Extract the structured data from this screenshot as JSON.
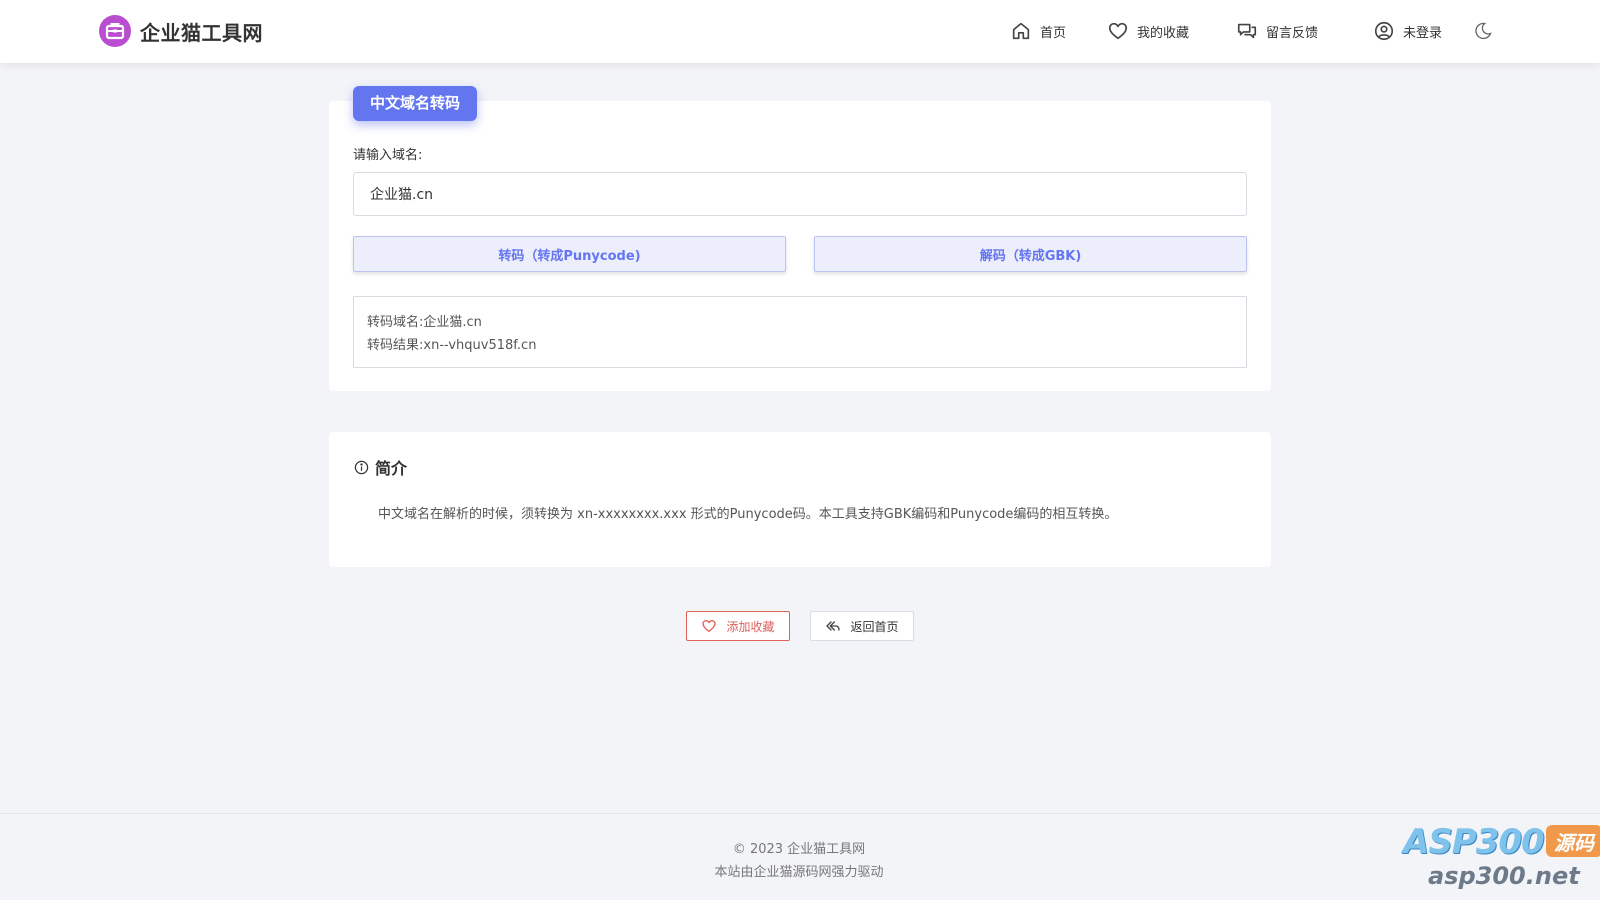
{
  "header": {
    "logo_text": "企业猫工具网",
    "nav": {
      "home": "首页",
      "favorites": "我的收藏",
      "feedback": "留言反馈",
      "login": "未登录"
    }
  },
  "tool": {
    "title": "中文域名转码",
    "input_label": "请输入域名:",
    "input_value": "企业猫.cn",
    "encode_button": "转码（转成Punycode)",
    "decode_button": "解码（转成GBK)",
    "result": {
      "domain_label": "转码域名:",
      "domain_value": "企业猫.cn",
      "result_label": "转码结果:",
      "result_value": "xn--vhquv518f.cn"
    }
  },
  "intro": {
    "title": "简介",
    "text": "中文域名在解析的时候，须转换为 xn-xxxxxxxx.xxx 形式的Punycode码。本工具支持GBK编码和Punycode编码的相互转换。"
  },
  "actions": {
    "add_favorite": "添加收藏",
    "back_home": "返回首页"
  },
  "footer": {
    "copyright": "© 2023 企业猫工具网",
    "powered": "本站由企业猫源码网强力驱动"
  },
  "watermark": {
    "brand": "ASP300",
    "badge": "源码",
    "url": "asp300.net"
  },
  "colors": {
    "accent": "#6476ef",
    "favorite": "#e0605a",
    "logo": "#b94fd0",
    "background": "#f3f4f8"
  }
}
